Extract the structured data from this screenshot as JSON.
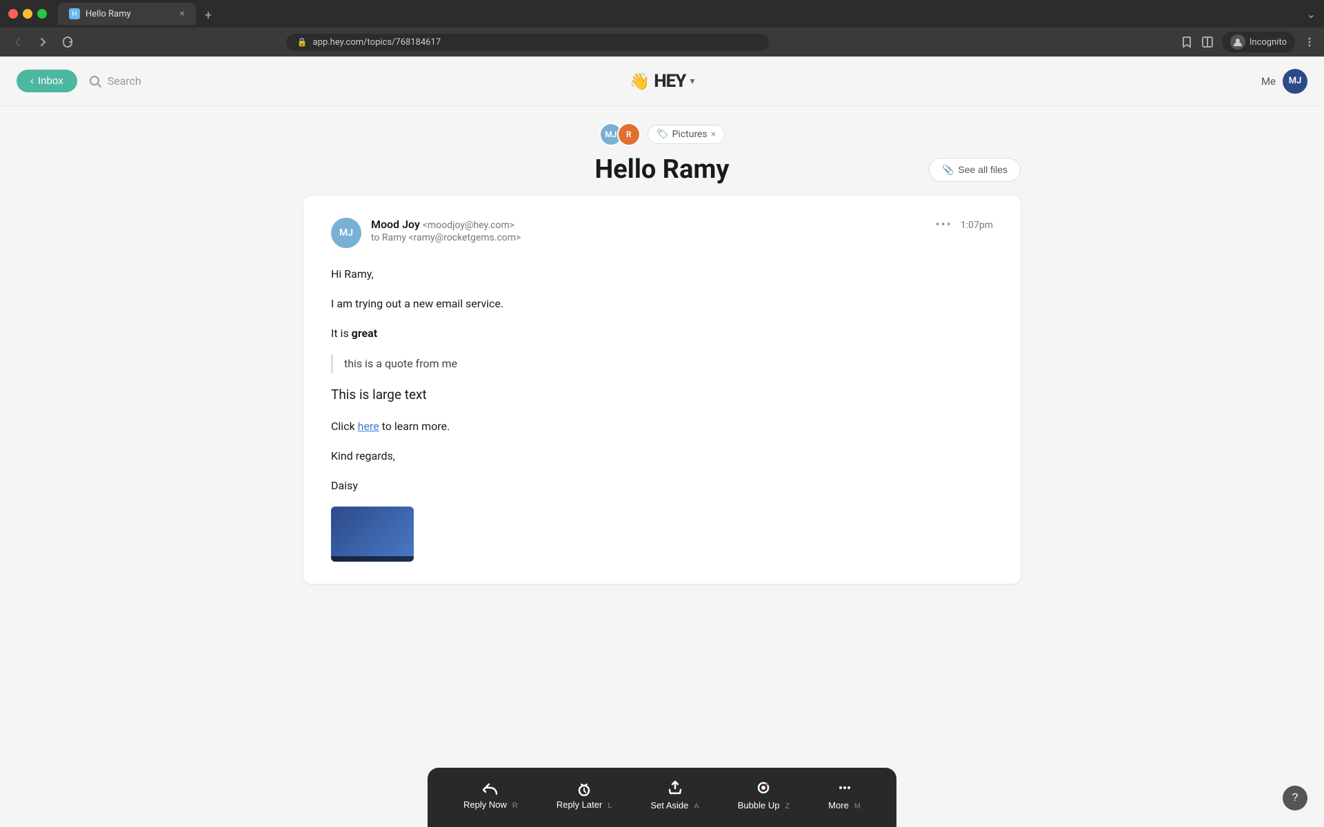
{
  "browser": {
    "tab_title": "Hello Ramy",
    "tab_close": "×",
    "tab_new": "+",
    "address": "app.hey.com/topics/768184617",
    "nav_back": "‹",
    "nav_forward": "›",
    "nav_refresh": "↻",
    "incognito_label": "Incognito",
    "chevron": "⌄"
  },
  "header": {
    "inbox_label": "Inbox",
    "inbox_arrow": "‹",
    "search_label": "Search",
    "logo_hand": "👋",
    "logo_text": "HEY",
    "logo_chevron": "▾",
    "me_label": "Me",
    "user_initials": "MJ"
  },
  "email_view": {
    "participants": {
      "avatar1_initials": "MJ",
      "avatar2_initials": "R"
    },
    "tag": {
      "label": "Pictures",
      "close": "×"
    },
    "title": "Hello Ramy",
    "see_all_files": "See all files",
    "email": {
      "sender_initials": "MJ",
      "sender_name": "Mood Joy",
      "sender_email": "<moodjoy@hey.com>",
      "to_label": "to Ramy",
      "to_email": "<ramy@rocketgems.com>",
      "more_dots": "•••",
      "time": "1:07pm",
      "body_line1": "Hi Ramy,",
      "body_line2": "I am trying out a new email service.",
      "body_line3_pre": "It is ",
      "body_line3_bold": "great",
      "quote_text": "this is a quote from me",
      "body_line4": "This is large text",
      "body_line5_pre": "Click ",
      "body_line5_link": "here",
      "body_line5_post": " to learn more.",
      "body_line6": "Kind regards,",
      "body_line7": "Daisy"
    }
  },
  "action_bar": {
    "reply_now_label": "Reply Now",
    "reply_now_key": "R",
    "reply_later_label": "Reply Later",
    "reply_later_key": "L",
    "set_aside_label": "Set Aside",
    "set_aside_key": "A",
    "bubble_up_label": "Bubble Up",
    "bubble_up_key": "Z",
    "more_label": "More",
    "more_key": "M"
  },
  "help": {
    "label": "?"
  }
}
